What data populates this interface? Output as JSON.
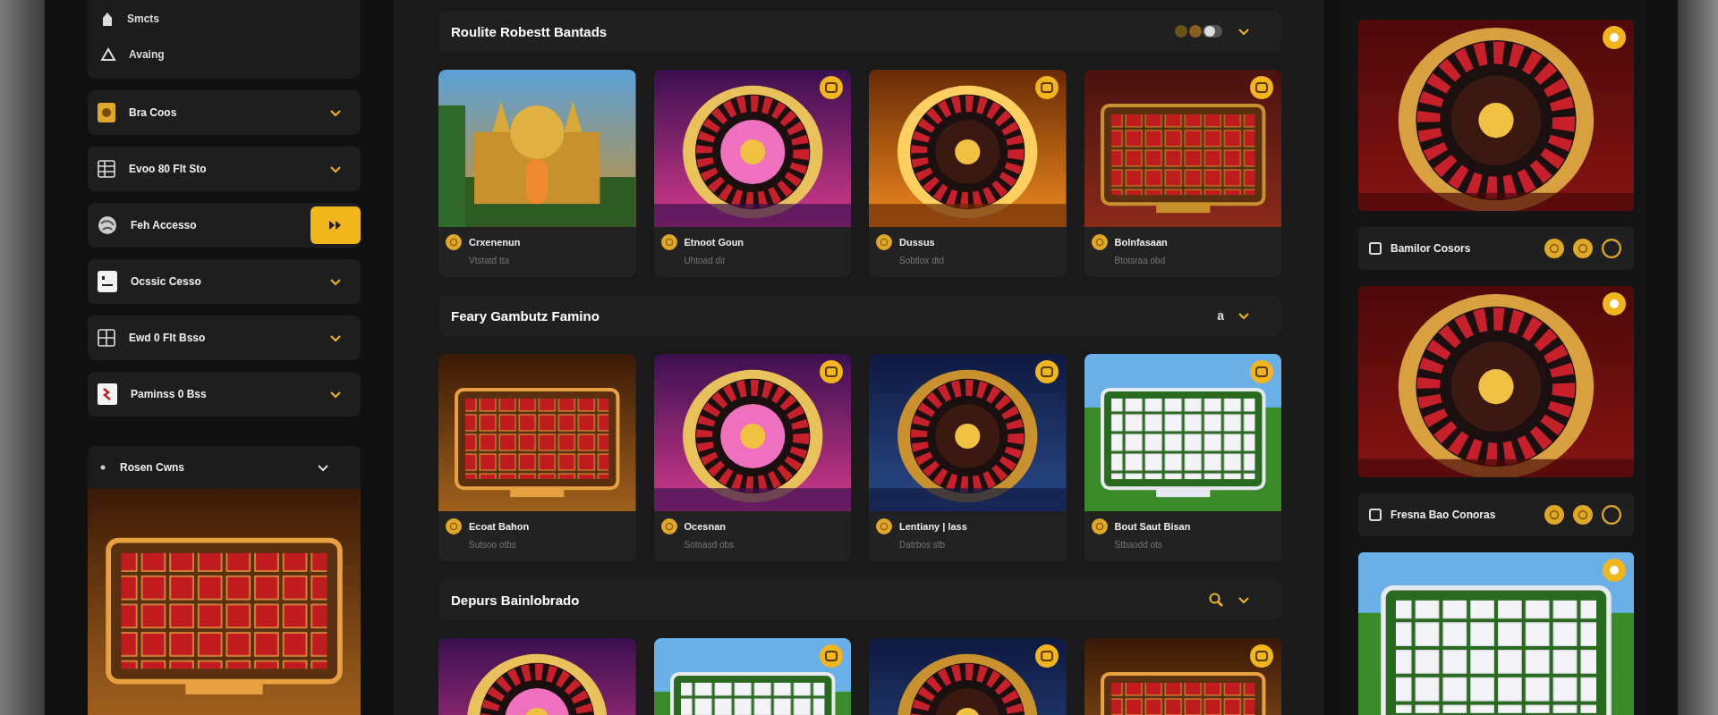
{
  "sidebar": {
    "top_items": [
      {
        "label": "Smcts"
      },
      {
        "label": "Avaing"
      }
    ],
    "items": [
      {
        "label": "Bra Coos",
        "kind": "accordion"
      },
      {
        "label": "Evoo 80 Flt Sto",
        "kind": "accordion"
      },
      {
        "label": "Feh Accesso",
        "kind": "play"
      },
      {
        "label": "Ocssic Cesso",
        "kind": "accordion"
      },
      {
        "label": "Ewd 0 Flt Bsso",
        "kind": "accordion"
      },
      {
        "label": "Paminss 0 Bss",
        "kind": "accordion"
      }
    ],
    "recent": {
      "title": "Rosen Cwns",
      "banner": {
        "kind": "picture"
      }
    }
  },
  "sections": [
    {
      "title": "Roulite Robestt Bantads",
      "kind": "toggle",
      "cards": [
        {
          "title": "Crxenenun",
          "subtitle": "Vtstatd tta"
        },
        {
          "title": "Etnoot Goun",
          "subtitle": "Uhtoad dir"
        },
        {
          "title": "Dussus",
          "subtitle": "Sobtlox dtd"
        },
        {
          "title": "Bolnfasaan",
          "subtitle": "Btotsraa obd"
        }
      ]
    },
    {
      "title": "Feary Gambutz Famino",
      "kind": "label",
      "control_text": "a",
      "cards": [
        {
          "title": "Ecoat Bahon",
          "subtitle": "Sutsoo otbs"
        },
        {
          "title": "Ocesnan",
          "subtitle": "Sotoasd obs"
        },
        {
          "title": "Lentiany | lass",
          "subtitle": "Datrbos stb"
        },
        {
          "title": "Bout Saut Bisan",
          "subtitle": "Stbaodd ots"
        }
      ]
    },
    {
      "title": "Depurs Bainlobrado",
      "kind": "search",
      "cards": [
        {
          "kind": "picture"
        },
        {
          "kind": "picture"
        },
        {
          "kind": "picture"
        },
        {
          "kind": "picture"
        }
      ]
    }
  ],
  "featured": [
    {
      "title": "Bamilor Cosors"
    },
    {
      "title": "Fresna Bao Conoras"
    },
    {
      "kind": "picture"
    }
  ]
}
